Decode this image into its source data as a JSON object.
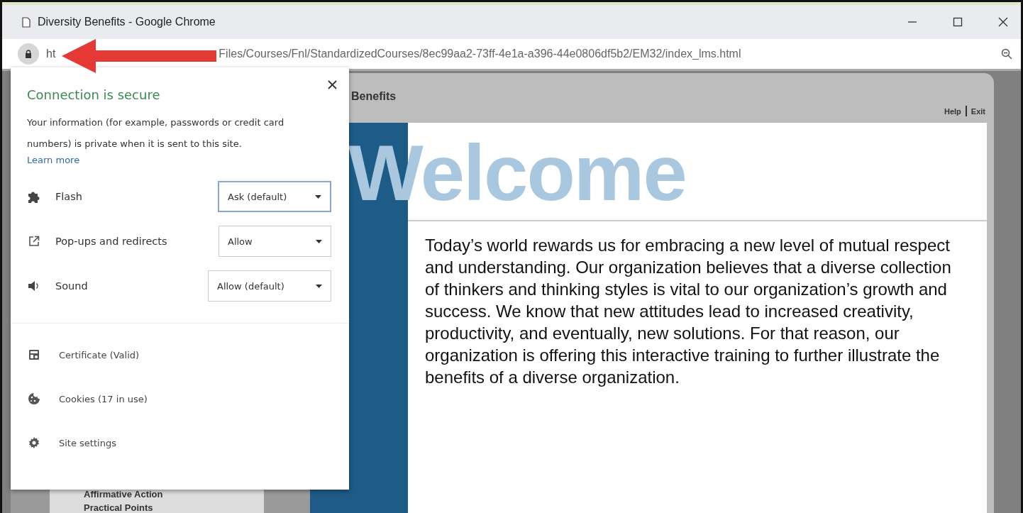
{
  "window": {
    "title": "Diversity Benefits - Google Chrome"
  },
  "address_bar": {
    "url_visible_start": "ht",
    "url_visible_end": "Files/Courses/Fnl/StandardizedCourses/8ec99aa2-73ff-4e1a-a396-44e0806df5b2/EM32/index_lms.html"
  },
  "course": {
    "title": "Benefits",
    "links": [
      "Help",
      "Exit"
    ],
    "heading": "Welcome",
    "body": "Today’s world rewards us for embracing a new level of mutual respect and understanding. Our organization believes that a diverse collection of thinkers and thinking styles is vital to our organization’s growth and success. We know that new attitudes lead to increased creativity, productivity, and eventually, new solutions. For that reason, our organization is offering this interactive training to further illustrate the benefits of a diverse organization.",
    "menu": [
      "Affirmative Action",
      "Practical Points"
    ]
  },
  "site_info_popup": {
    "title": "Connection is secure",
    "description": "Your information (for example, passwords or credit card numbers) is private when it is sent to this site.",
    "link": "Learn more",
    "permissions": [
      {
        "kind": "plugin",
        "label": "Flash",
        "value": "Ask (default)",
        "focused": true
      },
      {
        "kind": "popup",
        "label": "Pop-ups and redirects",
        "value": "Allow",
        "focused": false
      },
      {
        "kind": "sound",
        "label": "Sound",
        "value": "Allow (default)",
        "focused": false
      }
    ],
    "links": [
      {
        "kind": "certificate",
        "label": "Certificate (Valid)"
      },
      {
        "kind": "cookies",
        "label": "Cookies (17 in use)"
      },
      {
        "kind": "settings",
        "label": "Site settings"
      }
    ]
  }
}
